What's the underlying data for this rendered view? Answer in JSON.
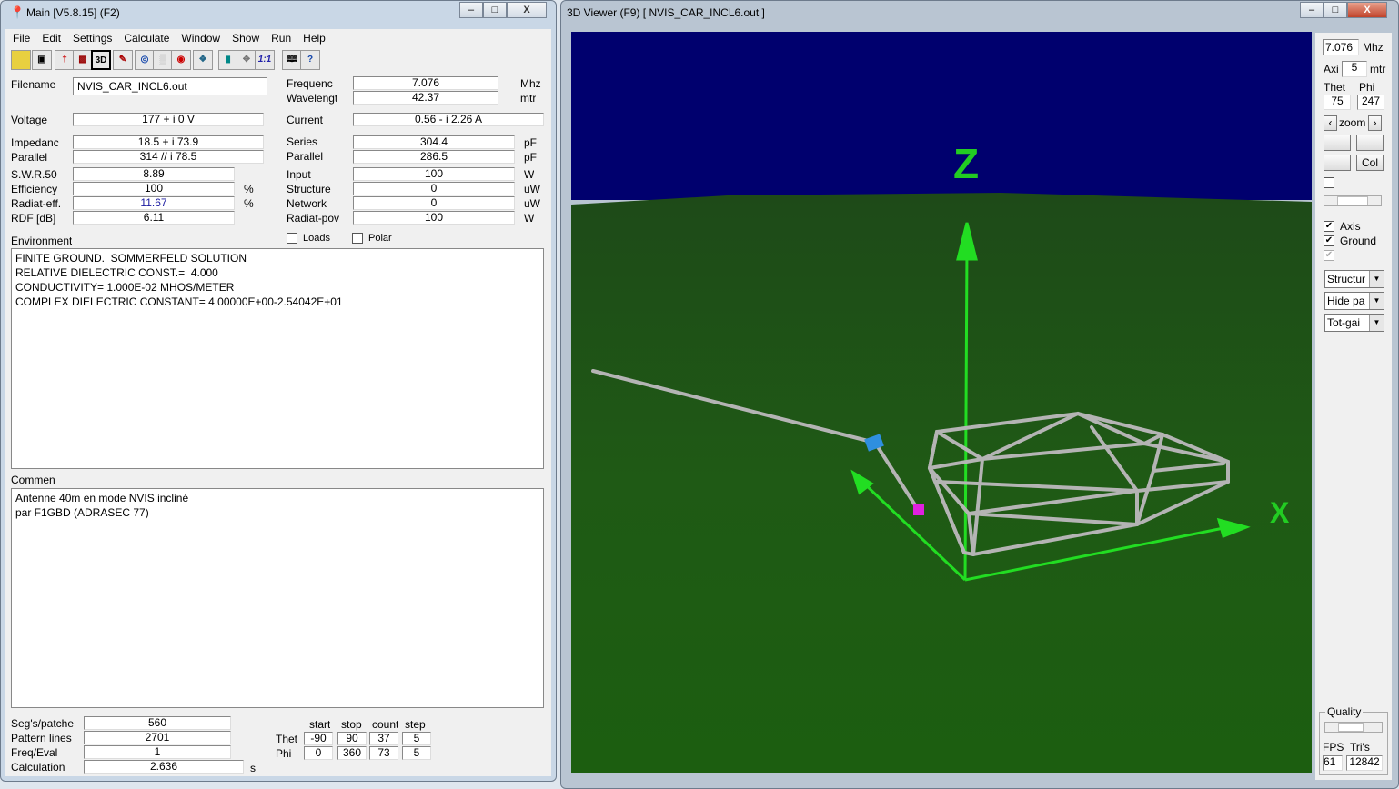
{
  "main": {
    "title": "Main [V5.8.15]  (F2)",
    "menu": [
      "File",
      "Edit",
      "Settings",
      "Calculate",
      "Window",
      "Show",
      "Run",
      "Help"
    ],
    "toolbar": [
      "open-folder",
      "save",
      "antenna",
      "structure-cube",
      "3D",
      "edit",
      "pattern",
      "nearfield",
      "smith",
      "optimize",
      "calculator",
      "compare",
      "1:1",
      "book",
      "help"
    ],
    "filename": {
      "label": "Filename",
      "value": "NVIS_CAR_INCL6.out"
    },
    "frequency": {
      "label": "Frequenc",
      "value": "7.076",
      "unit": "Mhz"
    },
    "wavelength": {
      "label": "Wavelengt",
      "value": "42.37",
      "unit": "mtr"
    },
    "voltage": {
      "label": "Voltage",
      "value": "177 + i 0 V"
    },
    "current": {
      "label": "Current",
      "value": "0.56 - i 2.26 A"
    },
    "impedance": {
      "label": "Impedanc",
      "value": "18.5 + i 73.9"
    },
    "parallel_z": {
      "label": "Parallel",
      "value": "314 // i 78.5"
    },
    "series": {
      "label": "Series",
      "value": "304.4",
      "unit": "pF"
    },
    "parallel_c": {
      "label": "Parallel",
      "value": "286.5",
      "unit": "pF"
    },
    "swr": {
      "label": "S.W.R.50",
      "value": "8.89"
    },
    "efficiency": {
      "label": "Efficiency",
      "value": "100",
      "unit": "%"
    },
    "radiat_eff": {
      "label": "Radiat-eff.",
      "value": "11.67",
      "unit": "%"
    },
    "rdf": {
      "label": "RDF [dB]",
      "value": "6.11"
    },
    "input": {
      "label": "Input",
      "value": "100",
      "unit": "W"
    },
    "structure": {
      "label": "Structure",
      "value": "0",
      "unit": "uW"
    },
    "network": {
      "label": "Network",
      "value": "0",
      "unit": "uW"
    },
    "radiat_pow": {
      "label": "Radiat-pov",
      "value": "100",
      "unit": "W"
    },
    "loads": {
      "label": "Loads",
      "checked": false
    },
    "polar": {
      "label": "Polar",
      "checked": false
    },
    "environment": {
      "label": "Environment",
      "text": "FINITE GROUND.  SOMMERFELD SOLUTION\nRELATIVE DIELECTRIC CONST.=  4.000\nCONDUCTIVITY= 1.000E-02 MHOS/METER\nCOMPLEX DIELECTRIC CONSTANT= 4.00000E+00-2.54042E+01"
    },
    "comment": {
      "label": "Commen",
      "text": "Antenne 40m en mode NVIS incliné\npar F1GBD (ADRASEC 77)"
    },
    "segs": {
      "label": "Seg's/patche",
      "value": "560"
    },
    "pattern_lines": {
      "label": "Pattern lines",
      "value": "2701"
    },
    "freq_eval": {
      "label": "Freq/Eval",
      "value": "1"
    },
    "calculation": {
      "label": "Calculation",
      "value": "2.636",
      "unit": "s"
    },
    "grid": {
      "headers": [
        "start",
        "stop",
        "count",
        "step"
      ],
      "theta": {
        "label": "Thet",
        "values": [
          "-90",
          "90",
          "37",
          "5"
        ]
      },
      "phi": {
        "label": "Phi",
        "values": [
          "0",
          "360",
          "73",
          "5"
        ]
      }
    }
  },
  "viewer": {
    "title": "3D Viewer (F9)     [  NVIS_CAR_INCL6.out ]",
    "freq": "7.076",
    "freq_unit": "Mhz",
    "axis_label": "Axi",
    "axis_value": "5",
    "axis_unit": "mtr",
    "theta_label": "Thet",
    "phi_label": "Phi",
    "theta": "75",
    "phi": "247",
    "zoom_label": "zoom",
    "btn_col": "Col",
    "axis_cb": {
      "label": "Axis",
      "checked": true
    },
    "ground_cb": {
      "label": "Ground",
      "checked": true
    },
    "dropdowns": [
      "Structur",
      "Hide pa",
      "Tot-gai"
    ],
    "quality_label": "Quality",
    "fps_label": "FPS",
    "tris_label": "Tri's",
    "fps": "61",
    "tris": "12842",
    "axis_labels": {
      "z": "Z",
      "x": "X"
    },
    "colors": {
      "sky": "#00006e",
      "ground": "#1e5a14",
      "axis": "#22dd22",
      "wire": "#b4b4b4",
      "source": "#2f8fdf",
      "load": "#e020e0"
    }
  }
}
